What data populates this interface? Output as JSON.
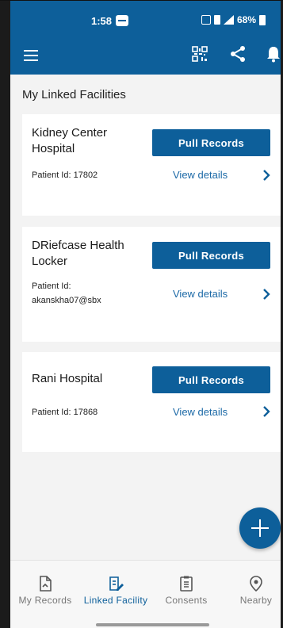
{
  "status_bar": {
    "time": "1:58",
    "battery": "68%"
  },
  "app_bar": {
    "icons": [
      "menu-icon",
      "qr-code-icon",
      "share-icon",
      "bell-icon"
    ],
    "color": "#0d5f9a"
  },
  "main": {
    "section_title": "My Linked Facilities",
    "facilities": [
      {
        "name_line1": "Kidney Center",
        "name_line2": "Hospital",
        "pid_line1": "Patient Id: 17802",
        "pid_line2": "",
        "button": "Pull Records",
        "link": "View details"
      },
      {
        "name_line1": "DRiefcase Health",
        "name_line2": "Locker",
        "pid_line1": "Patient Id:",
        "pid_line2": "akanskha07@sbx",
        "button": "Pull Records",
        "link": "View details"
      },
      {
        "name_line1": "Rani Hospital",
        "name_line2": "",
        "pid_line1": "Patient Id: 17868",
        "pid_line2": "",
        "button": "Pull Records",
        "link": "View details"
      }
    ]
  },
  "bottom_nav": {
    "items": [
      {
        "label": "My Records",
        "icon": "records-icon",
        "active": false
      },
      {
        "label": "Linked Facility",
        "icon": "linked-facility-icon",
        "active": true
      },
      {
        "label": "Consents",
        "icon": "clipboard-icon",
        "active": false
      },
      {
        "label": "Nearby",
        "icon": "location-pin-icon",
        "active": false
      }
    ]
  }
}
